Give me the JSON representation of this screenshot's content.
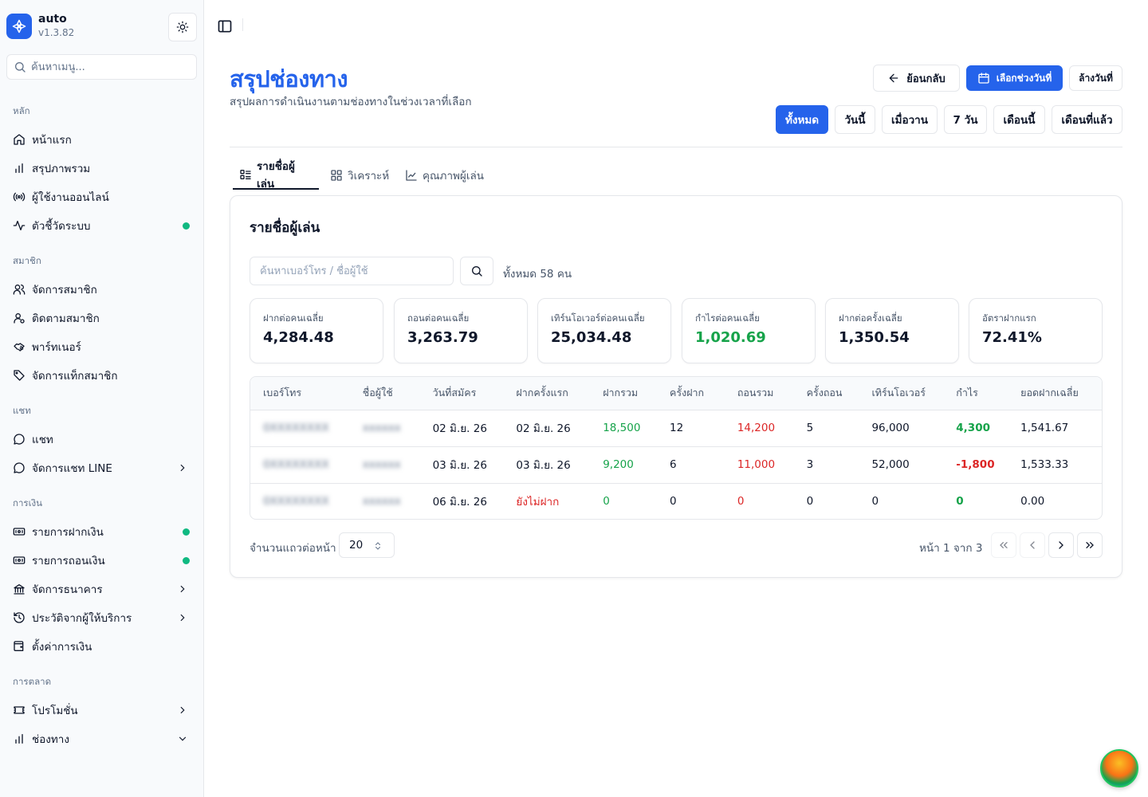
{
  "app": {
    "name": "auto",
    "version": "v1.3.82"
  },
  "sidebar": {
    "search_placeholder": "ค้นหาเมนู...",
    "groups": [
      {
        "label": "หลัก",
        "items": [
          {
            "label": "หน้าแรก",
            "icon": "home-icon"
          },
          {
            "label": "สรุปภาพรวม",
            "icon": "bar-chart-icon"
          },
          {
            "label": "ผู้ใช้งานออนไลน์",
            "icon": "radio-icon"
          },
          {
            "label": "ตัวชี้วัดระบบ",
            "icon": "activity-icon",
            "status_dot": "#10b981"
          }
        ]
      },
      {
        "label": "สมาชิก",
        "items": [
          {
            "label": "จัดการสมาชิก",
            "icon": "users-icon"
          },
          {
            "label": "ติดตามสมาชิก",
            "icon": "user-search-icon"
          },
          {
            "label": "พาร์ทเนอร์",
            "icon": "handshake-icon"
          },
          {
            "label": "จัดการแท็กสมาชิก",
            "icon": "tag-icon"
          }
        ]
      },
      {
        "label": "แชท",
        "items": [
          {
            "label": "แชท",
            "icon": "message-circle-icon"
          },
          {
            "label": "จัดการแชท LINE",
            "icon": "message-circle-icon",
            "expandable": true
          }
        ]
      },
      {
        "label": "การเงิน",
        "items": [
          {
            "label": "รายการฝากเงิน",
            "icon": "deposit-icon",
            "status_dot": "#10b981"
          },
          {
            "label": "รายการถอนเงิน",
            "icon": "withdraw-icon",
            "status_dot": "#10b981"
          },
          {
            "label": "จัดการธนาคาร",
            "icon": "bank-icon",
            "expandable": true
          },
          {
            "label": "ประวัติจากผู้ให้บริการ",
            "icon": "history-icon",
            "expandable": true
          },
          {
            "label": "ตั้งค่าการเงิน",
            "icon": "wallet-icon"
          }
        ]
      },
      {
        "label": "การตลาด",
        "items": [
          {
            "label": "โปรโมชั่น",
            "icon": "ticket-icon",
            "expandable": true
          },
          {
            "label": "ช่องทาง",
            "icon": "bar-chart-icon",
            "expanded": true
          }
        ]
      }
    ]
  },
  "page": {
    "title": "สรุปช่องทาง",
    "subtitle": "สรุปผลการดำเนินงานตามช่องทางในช่วงเวลาที่เลือก",
    "back_label": "ย้อนกลับ",
    "pick_date_label": "เลือกช่วงวันที่",
    "clear_date_label": "ล้างวันที่",
    "quick_ranges": [
      "ทั้งหมด",
      "วันนี้",
      "เมื่อวาน",
      "7 วัน",
      "เดือนนี้",
      "เดือนที่แล้ว"
    ],
    "active_range": "ทั้งหมด",
    "tabs": [
      "รายชื่อผู้เล่น",
      "วิเคราะห์",
      "คุณภาพผู้เล่น"
    ],
    "active_tab": "รายชื่อผู้เล่น"
  },
  "players": {
    "card_title": "รายชื่อผู้เล่น",
    "search_placeholder": "ค้นหาเบอร์โทร / ชื่อผู้ใช้",
    "total_text": "ทั้งหมด 58 คน",
    "stats": [
      {
        "label": "ฝากต่อคนเฉลี่ย",
        "value": "4,284.48",
        "color": "#0f172a"
      },
      {
        "label": "ถอนต่อคนเฉลี่ย",
        "value": "3,263.79",
        "color": "#0f172a"
      },
      {
        "label": "เทิร์นโอเวอร์ต่อคนเฉลี่ย",
        "value": "25,034.48",
        "color": "#0f172a"
      },
      {
        "label": "กำไรต่อคนเฉลี่ย",
        "value": "1,020.69",
        "color": "#16a34a"
      },
      {
        "label": "ฝากต่อครั้งเฉลี่ย",
        "value": "1,350.54",
        "color": "#0f172a"
      },
      {
        "label": "อัตราฝากแรก",
        "value": "72.41%",
        "color": "#0f172a"
      }
    ],
    "columns": [
      "เบอร์โทร",
      "ชื่อผู้ใช้",
      "วันที่สมัคร",
      "ฝากครั้งแรก",
      "ฝากรวม",
      "ครั้งฝาก",
      "ถอนรวม",
      "ครั้งถอน",
      "เทิร์นโอเวอร์",
      "กำไร",
      "ยอดฝากเฉลี่ย"
    ],
    "rows": [
      {
        "phone": "0XXXXXXXX",
        "username": "xxxxxx",
        "registered": "02 มิ.ย. 26",
        "first_deposit": "02 มิ.ย. 26",
        "total_deposit": "18,500",
        "deposit_count": "12",
        "total_withdraw": "14,200",
        "withdraw_count": "5",
        "turnover": "96,000",
        "profit": "4,300",
        "profit_sign": "pos",
        "avg_deposit": "1,541.67"
      },
      {
        "phone": "0XXXXXXXX",
        "username": "xxxxxx",
        "registered": "03 มิ.ย. 26",
        "first_deposit": "03 มิ.ย. 26",
        "total_deposit": "9,200",
        "deposit_count": "6",
        "total_withdraw": "11,000",
        "withdraw_count": "3",
        "turnover": "52,000",
        "profit": "-1,800",
        "profit_sign": "neg",
        "avg_deposit": "1,533.33"
      },
      {
        "phone": "0XXXXXXXX",
        "username": "xxxxxx",
        "registered": "06 มิ.ย. 26",
        "first_deposit": "ยังไม่ฝาก",
        "first_deposit_none": true,
        "total_deposit": "0",
        "deposit_count": "0",
        "total_withdraw": "0",
        "withdraw_count": "0",
        "turnover": "0",
        "profit": "0",
        "profit_sign": "pos",
        "avg_deposit": "0.00"
      }
    ],
    "rows_per_page_label": "จำนวนแถวต่อหน้า",
    "rows_per_page": "20",
    "page_info": "หน้า 1 จาก 3"
  },
  "colors": {
    "accent": "#2563eb",
    "positive": "#16a34a",
    "negative": "#dc2626",
    "online_dot": "#10b981"
  }
}
